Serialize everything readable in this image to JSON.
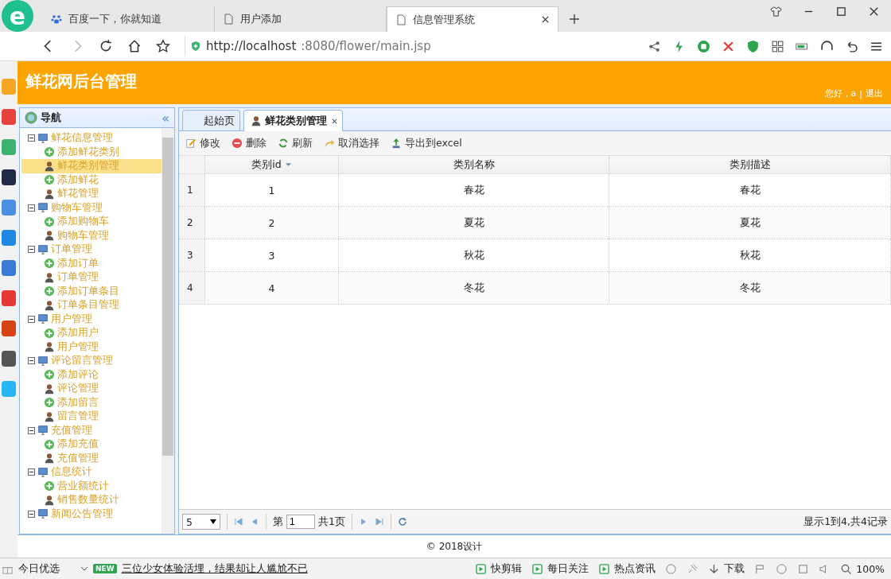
{
  "browser": {
    "logo": "e",
    "tabs": [
      {
        "title": "百度一下，你就知道",
        "kind": "paw",
        "selected": false
      },
      {
        "title": "用户添加",
        "kind": "page",
        "selected": false
      },
      {
        "title": "信息管理系统",
        "kind": "page",
        "selected": true
      }
    ],
    "url_host": "http://localhost",
    "url_rest": ":8080/flower/main.jsp"
  },
  "header": {
    "title": "鲜花网后台管理",
    "greeting": "您好，a",
    "separator": "|",
    "logout": "退出"
  },
  "nav": {
    "title": "导航",
    "collapse": "«",
    "tree": [
      {
        "label": "鲜花信息管理",
        "expanded": true,
        "children": [
          {
            "label": "添加鲜花类别",
            "kind": "add",
            "selected": false
          },
          {
            "label": "鲜花类别管理",
            "kind": "manage",
            "selected": true
          },
          {
            "label": "添加鲜花",
            "kind": "add",
            "selected": false
          },
          {
            "label": "鲜花管理",
            "kind": "manage",
            "selected": false
          }
        ]
      },
      {
        "label": "购物车管理",
        "expanded": true,
        "children": [
          {
            "label": "添加购物车",
            "kind": "add",
            "selected": false
          },
          {
            "label": "购物车管理",
            "kind": "manage",
            "selected": false
          }
        ]
      },
      {
        "label": "订单管理",
        "expanded": true,
        "children": [
          {
            "label": "添加订单",
            "kind": "add",
            "selected": false
          },
          {
            "label": "订单管理",
            "kind": "manage",
            "selected": false
          },
          {
            "label": "添加订单条目",
            "kind": "add",
            "selected": false
          },
          {
            "label": "订单条目管理",
            "kind": "manage",
            "selected": false
          }
        ]
      },
      {
        "label": "用户管理",
        "expanded": true,
        "children": [
          {
            "label": "添加用户",
            "kind": "add",
            "selected": false
          },
          {
            "label": "用户管理",
            "kind": "manage",
            "selected": false
          }
        ]
      },
      {
        "label": "评论留言管理",
        "expanded": true,
        "children": [
          {
            "label": "添加评论",
            "kind": "add",
            "selected": false
          },
          {
            "label": "评论管理",
            "kind": "manage",
            "selected": false
          },
          {
            "label": "添加留言",
            "kind": "add",
            "selected": false
          },
          {
            "label": "留言管理",
            "kind": "manage",
            "selected": false
          }
        ]
      },
      {
        "label": "充值管理",
        "expanded": true,
        "children": [
          {
            "label": "添加充值",
            "kind": "add",
            "selected": false
          },
          {
            "label": "充值管理",
            "kind": "manage",
            "selected": false
          }
        ]
      },
      {
        "label": "信息统计",
        "expanded": true,
        "children": [
          {
            "label": "营业额统计",
            "kind": "add",
            "selected": false
          },
          {
            "label": "销售数量统计",
            "kind": "manage",
            "selected": false
          }
        ]
      },
      {
        "label": "新闻公告管理",
        "expanded": true
      }
    ]
  },
  "content_tabs": [
    {
      "label": "起始页",
      "closable": false,
      "selected": false
    },
    {
      "label": "鲜花类别管理",
      "closable": true,
      "selected": true
    }
  ],
  "toolbar": [
    {
      "label": "修改",
      "kind": "edit"
    },
    {
      "label": "删除",
      "kind": "delete"
    },
    {
      "label": "刷新",
      "kind": "refresh"
    },
    {
      "label": "取消选择",
      "kind": "undo"
    },
    {
      "label": "导出到excel",
      "kind": "export"
    }
  ],
  "table": {
    "columns": [
      {
        "label": "类别id",
        "sorted": true
      },
      {
        "label": "类别名称",
        "sorted": false
      },
      {
        "label": "类别描述",
        "sorted": false
      }
    ],
    "rows": [
      {
        "index": "1",
        "cells": [
          "1",
          "春花",
          "春花"
        ]
      },
      {
        "index": "2",
        "cells": [
          "2",
          "夏花",
          "夏花"
        ]
      },
      {
        "index": "3",
        "cells": [
          "3",
          "秋花",
          "秋花"
        ]
      },
      {
        "index": "4",
        "cells": [
          "4",
          "冬花",
          "冬花"
        ]
      }
    ]
  },
  "pager": {
    "page_size": "5",
    "page_prefix": "第",
    "page": "1",
    "page_total": "共1页",
    "summary": "显示1到4,共4记录"
  },
  "footer": "© 2018设计",
  "status_bar": {
    "left": "今日优选",
    "badge": "NEW",
    "news": "三位少女体验活埋，结果却让人尴尬不已",
    "items": [
      "快剪辑",
      "每日关注",
      "热点资讯"
    ],
    "download": "下载",
    "zoom": "100%"
  }
}
